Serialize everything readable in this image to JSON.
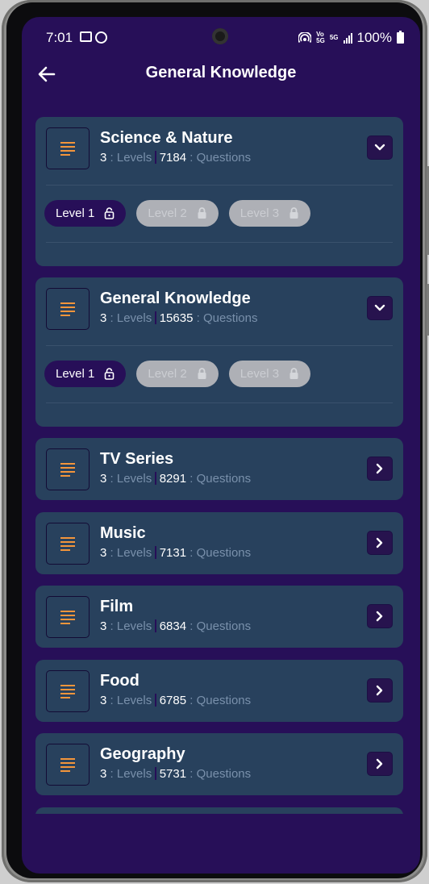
{
  "status_bar": {
    "time": "7:01",
    "battery": "100%",
    "network": "5G"
  },
  "header": {
    "title": "General Knowledge",
    "back_icon": "arrow-left-icon"
  },
  "meta_labels": {
    "levels": ": Levels",
    "questions": ": Questions"
  },
  "categories": [
    {
      "title": "Science & Nature",
      "levels": "3",
      "questions": "7184",
      "expanded": true,
      "level_pills": [
        {
          "label": "Level 1",
          "locked": false
        },
        {
          "label": "Level 2",
          "locked": true
        },
        {
          "label": "Level 3",
          "locked": true
        }
      ]
    },
    {
      "title": "General Knowledge",
      "levels": "3",
      "questions": "15635",
      "expanded": true,
      "level_pills": [
        {
          "label": "Level 1",
          "locked": false
        },
        {
          "label": "Level 2",
          "locked": true
        },
        {
          "label": "Level 3",
          "locked": true
        }
      ]
    },
    {
      "title": "TV Series",
      "levels": "3",
      "questions": "8291",
      "expanded": false
    },
    {
      "title": "Music",
      "levels": "3",
      "questions": "7131",
      "expanded": false
    },
    {
      "title": "Film",
      "levels": "3",
      "questions": "6834",
      "expanded": false
    },
    {
      "title": "Food",
      "levels": "3",
      "questions": "6785",
      "expanded": false
    },
    {
      "title": "Geography",
      "levels": "3",
      "questions": "5731",
      "expanded": false
    }
  ],
  "colors": {
    "background": "#270f58",
    "card": "#28415d",
    "accent_icon": "#f3953b",
    "muted_text": "#7990ab",
    "locked_pill": "#aeb0b6"
  }
}
